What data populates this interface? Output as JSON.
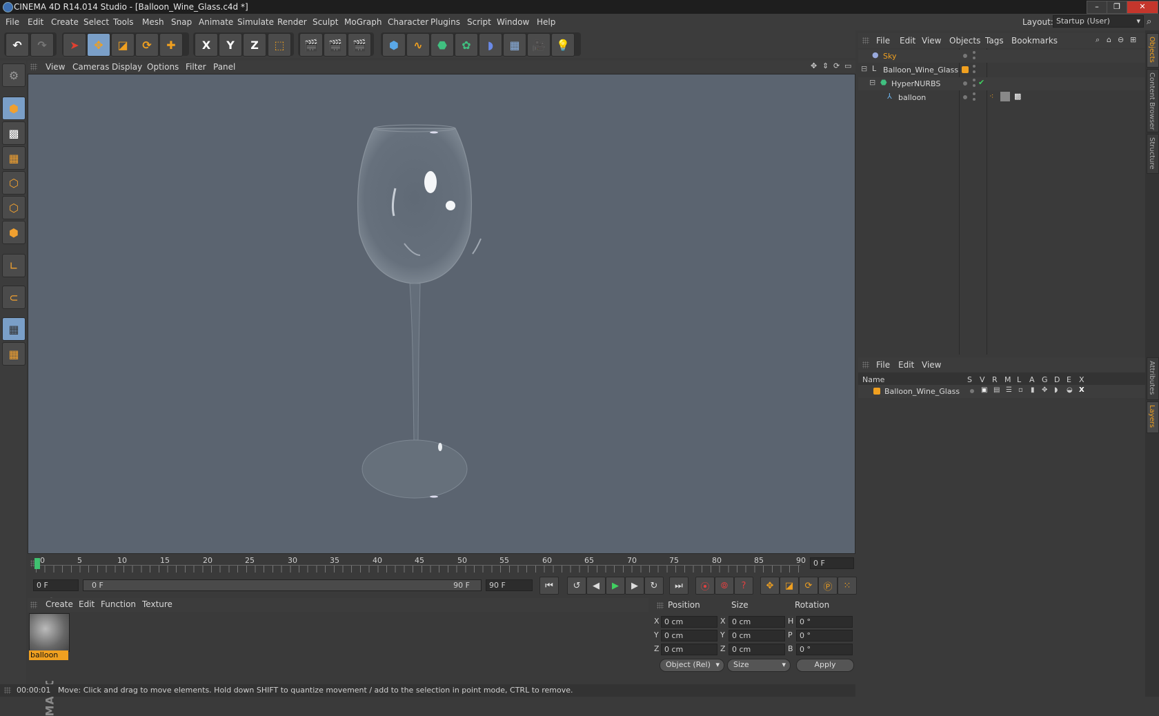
{
  "window": {
    "title": "CINEMA 4D R14.014 Studio - [Balloon_Wine_Glass.c4d *]",
    "minimize": "–",
    "restore": "❐",
    "close": "✕"
  },
  "menu": [
    "File",
    "Edit",
    "Create",
    "Select",
    "Tools",
    "Mesh",
    "Snap",
    "Animate",
    "Simulate",
    "Render",
    "Sculpt",
    "MoGraph",
    "Character",
    "Plugins",
    "Script",
    "Window",
    "Help"
  ],
  "layout": {
    "label": "Layout:",
    "value": "Startup (User)"
  },
  "toolbar": {
    "axis_x": "X",
    "axis_y": "Y",
    "axis_z": "Z"
  },
  "viewport_menu": [
    "View",
    "Cameras",
    "Display",
    "Options",
    "Filter",
    "Panel"
  ],
  "timeline": {
    "ticks": [
      "0",
      "5",
      "10",
      "15",
      "20",
      "25",
      "30",
      "35",
      "40",
      "45",
      "50",
      "55",
      "60",
      "65",
      "70",
      "75",
      "80",
      "85",
      "90"
    ],
    "current_frame_field": "0 F",
    "start_field": "0 F",
    "range_start": "0 F",
    "range_end": "90 F",
    "end_field": "90 F"
  },
  "material_menu": [
    "Create",
    "Edit",
    "Function",
    "Texture"
  ],
  "material": {
    "name": "balloon"
  },
  "coordinates": {
    "headers": [
      "Position",
      "Size",
      "Rotation"
    ],
    "position": [
      {
        "axis": "X",
        "value": "0 cm"
      },
      {
        "axis": "Y",
        "value": "0 cm"
      },
      {
        "axis": "Z",
        "value": "0 cm"
      }
    ],
    "size": [
      {
        "axis": "X",
        "value": "0 cm"
      },
      {
        "axis": "Y",
        "value": "0 cm"
      },
      {
        "axis": "Z",
        "value": "0 cm"
      }
    ],
    "rotation": [
      {
        "axis": "H",
        "value": "0 °"
      },
      {
        "axis": "P",
        "value": "0 °"
      },
      {
        "axis": "B",
        "value": "0 °"
      }
    ],
    "mode_select": "Object (Rel)",
    "size_select": "Size",
    "apply": "Apply"
  },
  "status": {
    "time": "00:00:01",
    "message": "Move: Click and drag to move elements. Hold down SHIFT to quantize movement / add to the selection in point mode, CTRL to remove."
  },
  "object_manager": {
    "menu": [
      "File",
      "Edit",
      "View",
      "Objects",
      "Tags",
      "Bookmarks"
    ],
    "objects": [
      {
        "name": "Sky",
        "color": "#f0a020"
      },
      {
        "name": "Balloon_Wine_Glass",
        "color": "#d8d8d8"
      },
      {
        "name": "HyperNURBS",
        "color": "#d8d8d8"
      },
      {
        "name": "balloon",
        "color": "#d8d8d8"
      }
    ]
  },
  "layer_manager": {
    "menu": [
      "File",
      "Edit",
      "View"
    ],
    "columns": [
      "Name",
      "S",
      "V",
      "R",
      "M",
      "L",
      "A",
      "G",
      "D",
      "E",
      "X"
    ],
    "layers": [
      {
        "name": "Balloon_Wine_Glass",
        "color": "#f0a020"
      }
    ]
  },
  "side_tabs": [
    "Objects",
    "Content Browser",
    "Structure",
    "Attributes",
    "Layers"
  ]
}
